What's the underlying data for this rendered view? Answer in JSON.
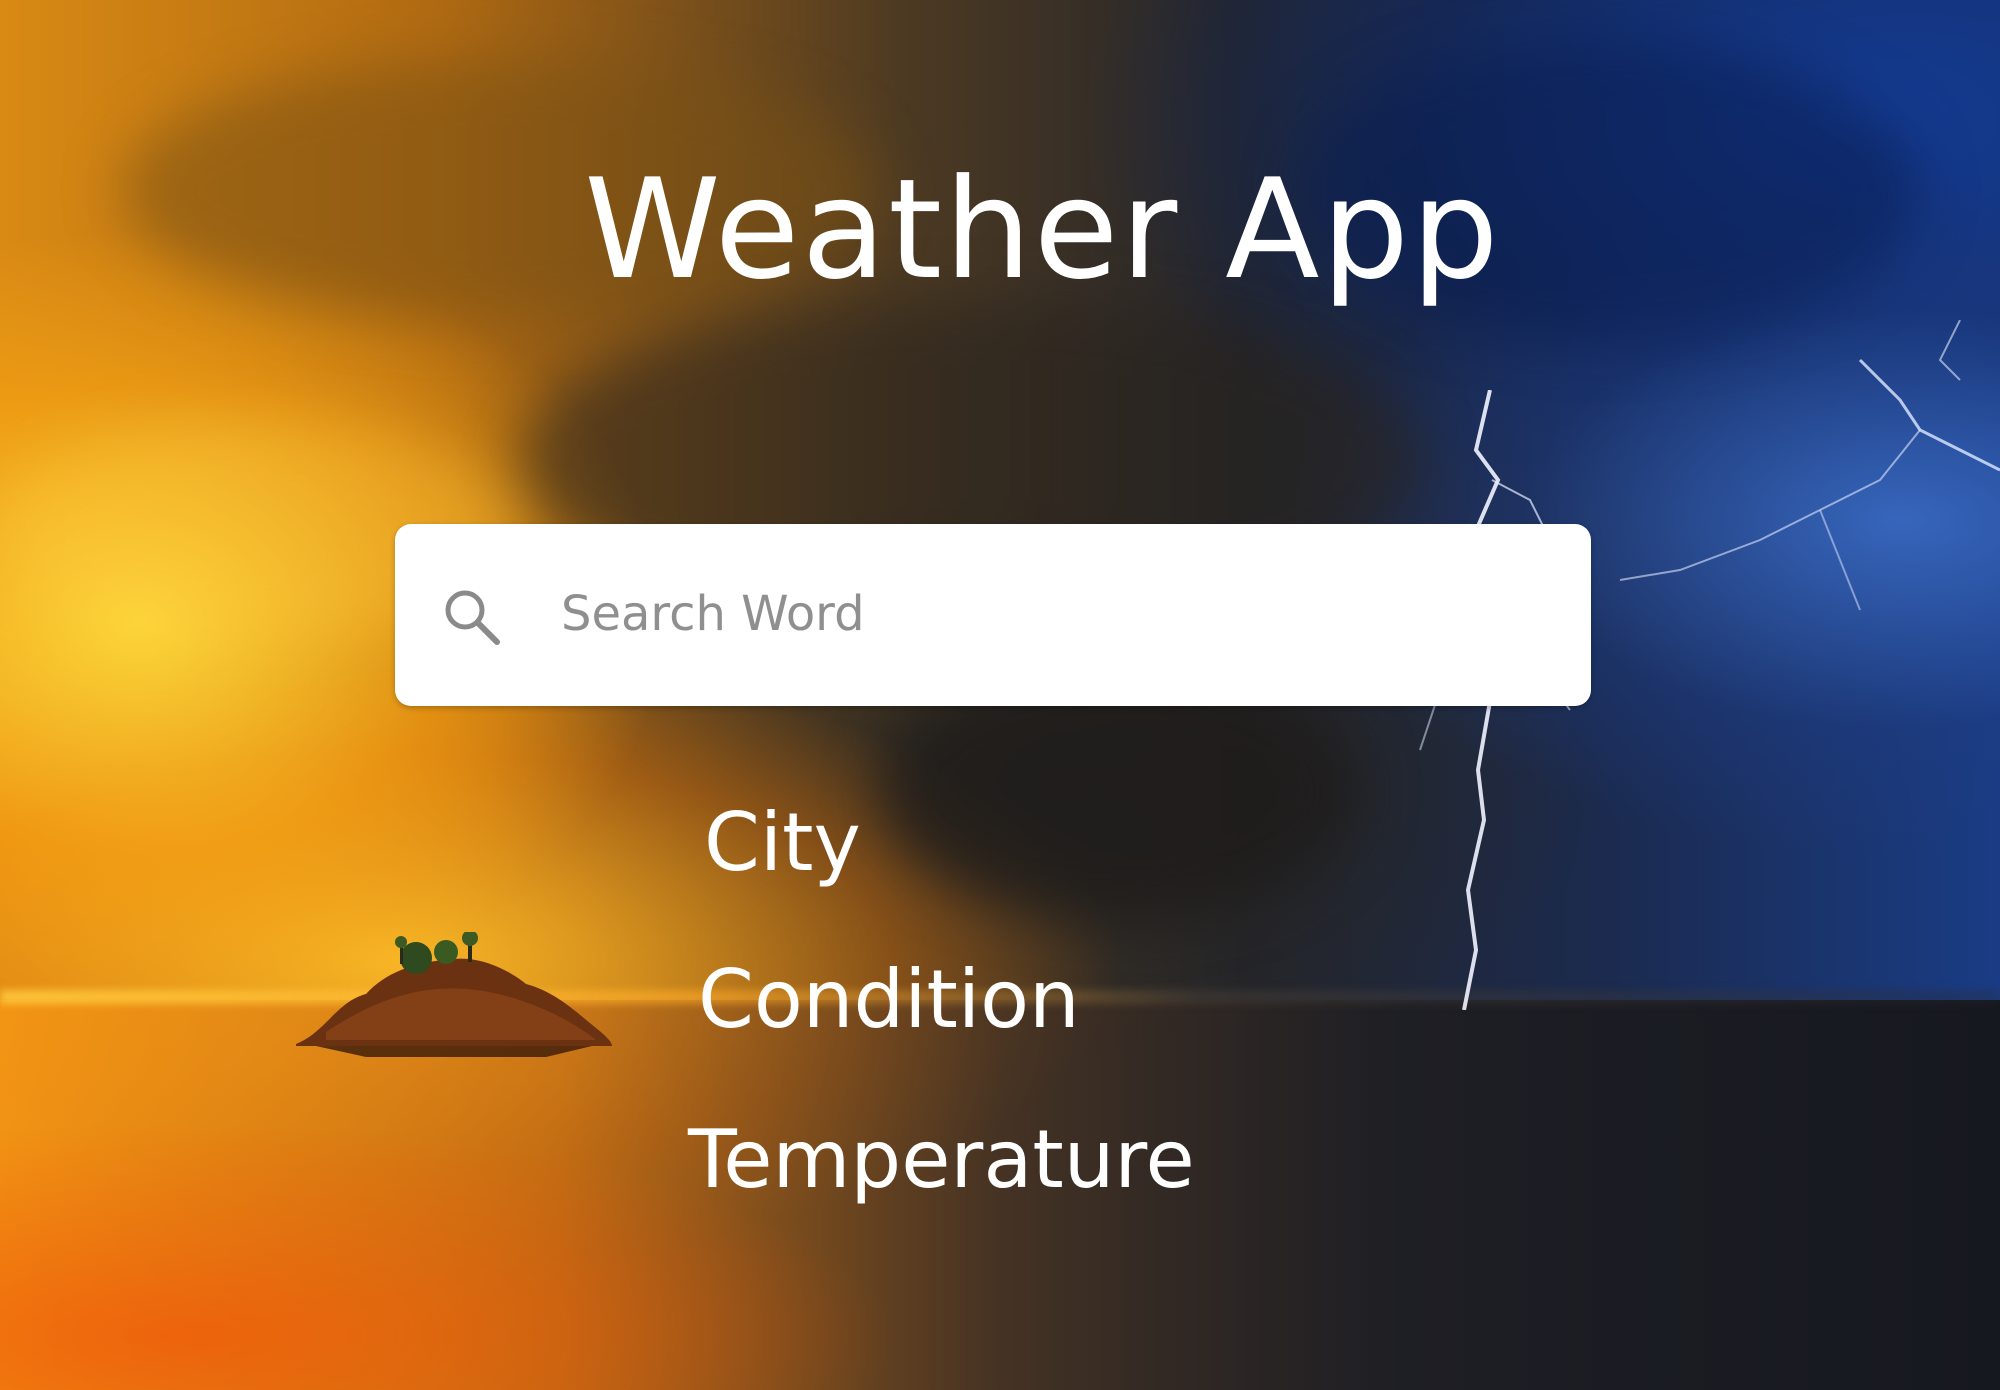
{
  "app": {
    "title": "Weather App"
  },
  "search": {
    "placeholder": "Search Word",
    "value": "",
    "icon": "search-icon"
  },
  "results": {
    "city_label": "City",
    "condition_label": "Condition",
    "temperature_label": "Temperature"
  },
  "background": {
    "description_icon": "sunset-and-storm-icon",
    "colors": {
      "sunset": "#e8960f",
      "storm": "#1a3c85",
      "text": "#ffffff",
      "search_bg": "#ffffff",
      "placeholder": "#8f8f8f"
    }
  }
}
